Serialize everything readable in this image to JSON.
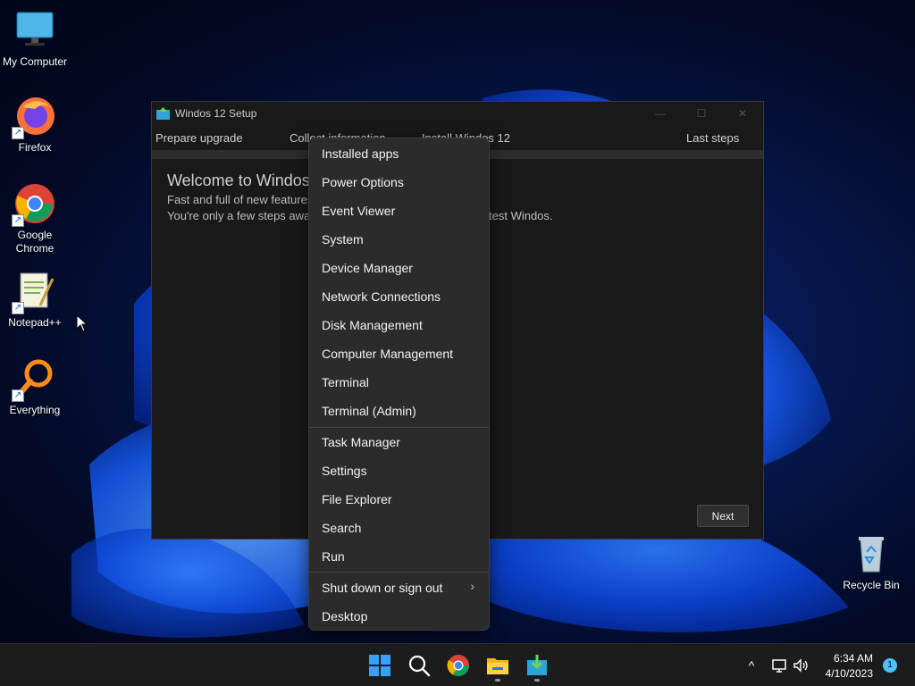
{
  "desktop": {
    "icons": [
      {
        "label": "My Computer"
      },
      {
        "label": "Firefox"
      },
      {
        "label": "Google Chrome"
      },
      {
        "label": "Notepad++"
      },
      {
        "label": "Everything"
      },
      {
        "label": "Recycle Bin"
      }
    ]
  },
  "setup_window": {
    "title": "Windos 12 Setup",
    "steps": [
      "Prepare upgrade",
      "Collect information",
      "Install Windos 12",
      "Last steps"
    ],
    "welcome": "Welcome to Windos",
    "line1": "Fast and full of new features",
    "line2_left": "You're only a few steps away",
    "line2_right": "test Windos.",
    "next_label": "Next"
  },
  "context_menu": {
    "group1": [
      "Installed apps",
      "Power Options",
      "Event Viewer",
      "System",
      "Device Manager",
      "Network Connections",
      "Disk Management",
      "Computer Management",
      "Terminal",
      "Terminal (Admin)"
    ],
    "group2": [
      "Task Manager",
      "Settings",
      "File Explorer",
      "Search",
      "Run"
    ],
    "group3": [
      "Shut down or sign out",
      "Desktop"
    ],
    "submenu_chevron": "›"
  },
  "taskbar": {
    "time": "6:34 AM",
    "date": "4/10/2023",
    "notification_count": "1",
    "pinned": [
      "start-icon",
      "search-icon",
      "chrome-icon",
      "file-explorer-icon",
      "setup-icon"
    ]
  },
  "colors": {
    "accent": "#1a6cff",
    "menu_bg": "#2b2b2b",
    "window_bg": "#191919",
    "taskbar_bg": "#1c1c1c",
    "notification": "#4cc2ff"
  }
}
